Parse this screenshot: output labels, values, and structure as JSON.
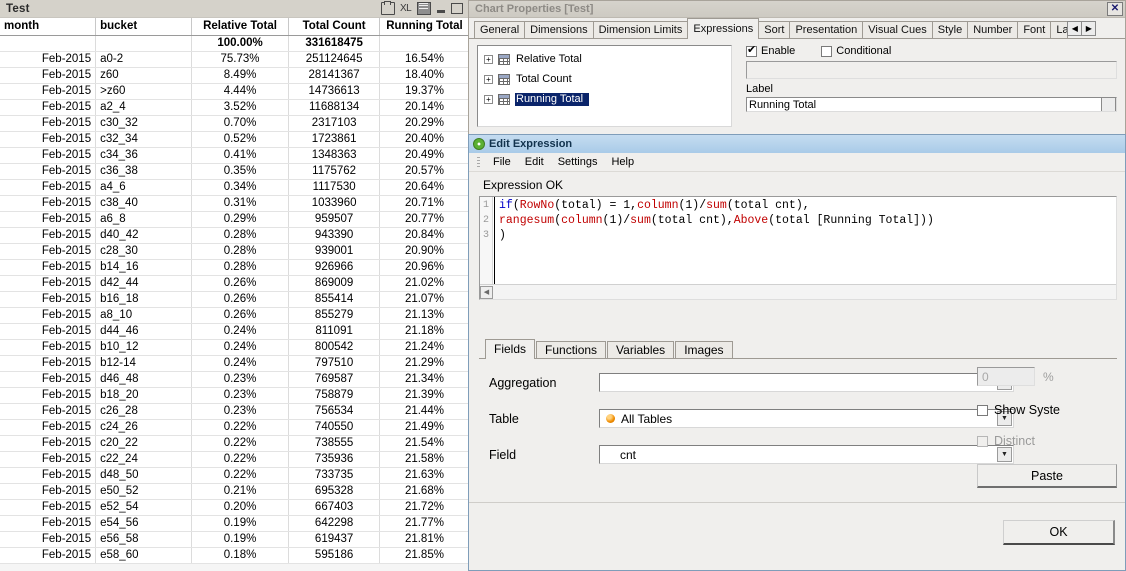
{
  "test_window": {
    "title": "Test",
    "titlebar_icons": [
      {
        "name": "print-icon",
        "glyph": "print"
      },
      {
        "name": "export-excel-icon",
        "glyph": "XL"
      },
      {
        "name": "copy-to-clipboard-icon",
        "glyph": "copy"
      },
      {
        "name": "minimize-icon",
        "glyph": "minimize"
      },
      {
        "name": "maximize-icon",
        "glyph": "maximize"
      }
    ],
    "columns": [
      "month",
      "bucket",
      "Relative Total",
      "Total Count",
      "Running Total"
    ],
    "total_row": [
      "",
      "",
      "100.00%",
      "331618475",
      ""
    ],
    "rows": [
      [
        "Feb-2015",
        "a0-2",
        "75.73%",
        "251124645",
        "16.54%"
      ],
      [
        "Feb-2015",
        "z60",
        "8.49%",
        "28141367",
        "18.40%"
      ],
      [
        "Feb-2015",
        ">z60",
        "4.44%",
        "14736613",
        "19.37%"
      ],
      [
        "Feb-2015",
        "a2_4",
        "3.52%",
        "11688134",
        "20.14%"
      ],
      [
        "Feb-2015",
        "c30_32",
        "0.70%",
        "2317103",
        "20.29%"
      ],
      [
        "Feb-2015",
        "c32_34",
        "0.52%",
        "1723861",
        "20.40%"
      ],
      [
        "Feb-2015",
        "c34_36",
        "0.41%",
        "1348363",
        "20.49%"
      ],
      [
        "Feb-2015",
        "c36_38",
        "0.35%",
        "1175762",
        "20.57%"
      ],
      [
        "Feb-2015",
        "a4_6",
        "0.34%",
        "1117530",
        "20.64%"
      ],
      [
        "Feb-2015",
        "c38_40",
        "0.31%",
        "1033960",
        "20.71%"
      ],
      [
        "Feb-2015",
        "a6_8",
        "0.29%",
        "959507",
        "20.77%"
      ],
      [
        "Feb-2015",
        "d40_42",
        "0.28%",
        "943390",
        "20.84%"
      ],
      [
        "Feb-2015",
        "c28_30",
        "0.28%",
        "939001",
        "20.90%"
      ],
      [
        "Feb-2015",
        "b14_16",
        "0.28%",
        "926966",
        "20.96%"
      ],
      [
        "Feb-2015",
        "d42_44",
        "0.26%",
        "869009",
        "21.02%"
      ],
      [
        "Feb-2015",
        "b16_18",
        "0.26%",
        "855414",
        "21.07%"
      ],
      [
        "Feb-2015",
        "a8_10",
        "0.26%",
        "855279",
        "21.13%"
      ],
      [
        "Feb-2015",
        "d44_46",
        "0.24%",
        "811091",
        "21.18%"
      ],
      [
        "Feb-2015",
        "b10_12",
        "0.24%",
        "800542",
        "21.24%"
      ],
      [
        "Feb-2015",
        "b12-14",
        "0.24%",
        "797510",
        "21.29%"
      ],
      [
        "Feb-2015",
        "d46_48",
        "0.23%",
        "769587",
        "21.34%"
      ],
      [
        "Feb-2015",
        "b18_20",
        "0.23%",
        "758879",
        "21.39%"
      ],
      [
        "Feb-2015",
        "c26_28",
        "0.23%",
        "756534",
        "21.44%"
      ],
      [
        "Feb-2015",
        "c24_26",
        "0.22%",
        "740550",
        "21.49%"
      ],
      [
        "Feb-2015",
        "c20_22",
        "0.22%",
        "738555",
        "21.54%"
      ],
      [
        "Feb-2015",
        "c22_24",
        "0.22%",
        "735936",
        "21.58%"
      ],
      [
        "Feb-2015",
        "d48_50",
        "0.22%",
        "733735",
        "21.63%"
      ],
      [
        "Feb-2015",
        "e50_52",
        "0.21%",
        "695328",
        "21.68%"
      ],
      [
        "Feb-2015",
        "e52_54",
        "0.20%",
        "667403",
        "21.72%"
      ],
      [
        "Feb-2015",
        "e54_56",
        "0.19%",
        "642298",
        "21.77%"
      ],
      [
        "Feb-2015",
        "e56_58",
        "0.19%",
        "619437",
        "21.81%"
      ],
      [
        "Feb-2015",
        "e58_60",
        "0.18%",
        "595186",
        "21.85%"
      ]
    ]
  },
  "chart_properties": {
    "title": "Chart Properties [Test]",
    "close_label": "✕",
    "tabs": [
      {
        "label": "General",
        "active": false
      },
      {
        "label": "Dimensions",
        "active": false
      },
      {
        "label": "Dimension Limits",
        "active": false
      },
      {
        "label": "Expressions",
        "active": true
      },
      {
        "label": "Sort",
        "active": false
      },
      {
        "label": "Presentation",
        "active": false
      },
      {
        "label": "Visual Cues",
        "active": false
      },
      {
        "label": "Style",
        "active": false
      },
      {
        "label": "Number",
        "active": false
      },
      {
        "label": "Font",
        "active": false
      },
      {
        "label": "La",
        "active": false
      }
    ],
    "tab_scroll_left": "◀",
    "tab_scroll_right": "▶",
    "expressions": [
      {
        "label": "Relative Total",
        "selected": false,
        "expand": "+"
      },
      {
        "label": "Total Count",
        "selected": false,
        "expand": "+"
      },
      {
        "label": "Running Total",
        "selected": true,
        "expand": "+"
      }
    ],
    "enable_label": "Enable",
    "enable_checked": true,
    "conditional_label": "Conditional",
    "conditional_checked": false,
    "conditional_value": "",
    "label_caption": "Label",
    "label_value": "Running Total",
    "selection_color": "#0a246a"
  },
  "edit_expression": {
    "title": "Edit Expression",
    "menu": [
      "File",
      "Edit",
      "Settings",
      "Help"
    ],
    "status": "Expression OK",
    "line_numbers": [
      "1",
      "2",
      "3"
    ],
    "code_lines": [
      [
        {
          "t": "if",
          "c": "kw"
        },
        {
          "t": "(",
          "c": "pl"
        },
        {
          "t": "RowNo",
          "c": "fn"
        },
        {
          "t": "(total) = 1,",
          "c": "pl"
        },
        {
          "t": "column",
          "c": "fn"
        },
        {
          "t": "(1)/",
          "c": "pl"
        },
        {
          "t": "sum",
          "c": "fn"
        },
        {
          "t": "(total cnt),",
          "c": "pl"
        }
      ],
      [
        {
          "t": "rangesum",
          "c": "fn"
        },
        {
          "t": "(",
          "c": "pl"
        },
        {
          "t": "column",
          "c": "fn"
        },
        {
          "t": "(1)/",
          "c": "pl"
        },
        {
          "t": "sum",
          "c": "fn"
        },
        {
          "t": "(total cnt),",
          "c": "pl"
        },
        {
          "t": "Above",
          "c": "fn"
        },
        {
          "t": "(total [Running Total]))",
          "c": "pl"
        }
      ],
      [
        {
          "t": ")",
          "c": "pl"
        }
      ]
    ],
    "code_plain": "if(RowNo(total) = 1,column(1)/sum(total cnt),\nrangesum(column(1)/sum(total cnt),Above(total [Running Total]))\n)",
    "panel_tabs": [
      {
        "label": "Fields",
        "active": true
      },
      {
        "label": "Functions",
        "active": false
      },
      {
        "label": "Variables",
        "active": false
      },
      {
        "label": "Images",
        "active": false
      }
    ],
    "aggregation_label": "Aggregation",
    "aggregation_value": "",
    "table_label": "Table",
    "table_value": "All Tables",
    "field_label": "Field",
    "field_value": "cnt",
    "percent_value": "0",
    "percent_sign": "%",
    "show_system_label": "Show Syste",
    "show_system_checked": false,
    "distinct_label": "Distinct",
    "distinct_checked": false,
    "distinct_disabled": true,
    "paste_label": "Paste",
    "ok_label": "OK",
    "titlebar_color": "#a9cbe8"
  }
}
